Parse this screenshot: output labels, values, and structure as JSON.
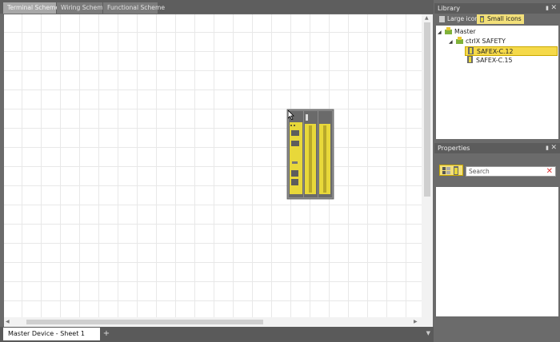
{
  "tabs": [
    {
      "label": "Terminal Scheme",
      "active": true
    },
    {
      "label": "Wiring Scheme",
      "active": false
    },
    {
      "label": "Functional Scheme",
      "active": false
    }
  ],
  "sheet": {
    "tab_label": "Master Device - Sheet 1",
    "add_label": "+"
  },
  "library": {
    "title": "Library",
    "large_icons_label": "Large icons",
    "small_icons_label": "Small icons",
    "tree": {
      "root": "Master",
      "group": "ctrlX SAFETY",
      "items": [
        "SAFEX-C.12",
        "SAFEX-C.15"
      ],
      "selected_index": 0
    }
  },
  "properties": {
    "title": "Properties",
    "search_placeholder": "Search"
  },
  "colors": {
    "accent": "#f5d94a",
    "device_yellow": "#e8d83a",
    "device_dark": "#5a5a5a"
  }
}
